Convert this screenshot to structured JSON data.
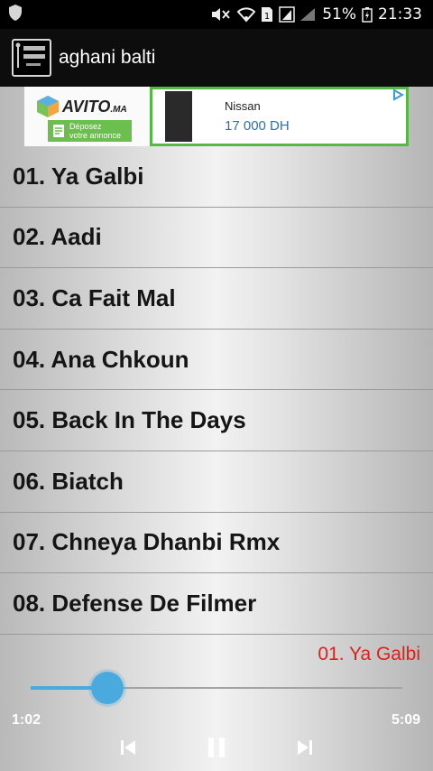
{
  "status_bar": {
    "battery_percent": "51%",
    "time": "21:33",
    "icons": [
      "shield-icon",
      "mute-icon",
      "wifi-icon",
      "sim-icon",
      "signal-icon",
      "battery-icon"
    ]
  },
  "app_bar": {
    "title": "aghani balti",
    "logo_icon": "app-logo-icon"
  },
  "ad": {
    "brand": "AVITO",
    "brand_suffix": ".MA",
    "cta_line1": "Déposez",
    "cta_line2": "votre annonce",
    "title": "Nissan",
    "price": "17 000 DH",
    "choice_icon": "ad-choices-icon"
  },
  "tracks": [
    {
      "label": "01. Ya Galbi"
    },
    {
      "label": "02. Aadi"
    },
    {
      "label": "03. Ca Fait Mal"
    },
    {
      "label": "04. Ana Chkoun"
    },
    {
      "label": "05. Back In The Days"
    },
    {
      "label": "06. Biatch"
    },
    {
      "label": "07. Chneya Dhanbi Rmx"
    },
    {
      "label": "08. Defense De Filmer"
    }
  ],
  "player": {
    "now_playing": "01. Ya Galbi",
    "current_time": "1:02",
    "total_time": "5:09",
    "progress": 0.206,
    "controls": [
      "previous-icon",
      "pause-icon",
      "next-icon"
    ]
  },
  "colors": {
    "accent": "#4aa9dd",
    "now_playing": "#e0201a",
    "ad_border": "#55b842"
  }
}
